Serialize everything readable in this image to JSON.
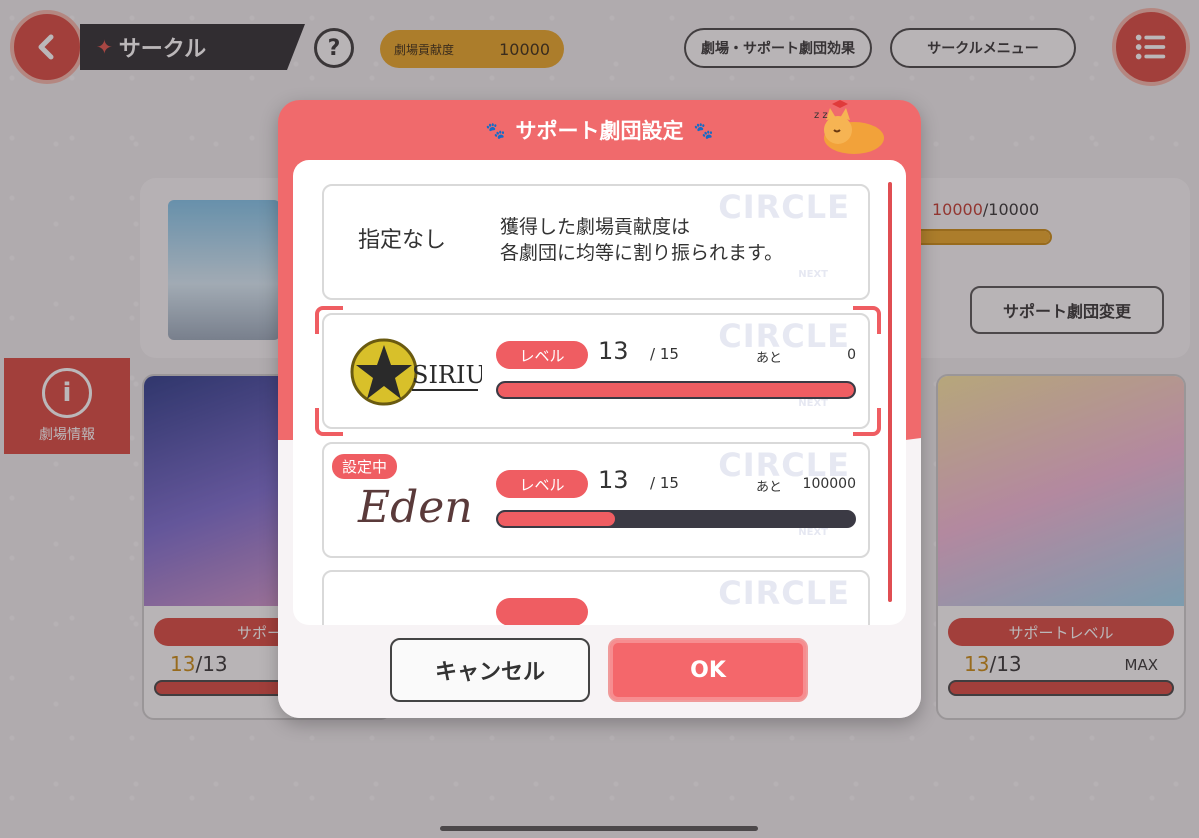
{
  "topbar": {
    "title": "サークル",
    "help_label": "?",
    "contribution_label": "劇場貢献度",
    "contribution_value": "10000",
    "effects_button": "劇場・サポート劇団効果",
    "menu_button": "サークルメニュー"
  },
  "theater": {
    "progress_current": "10000",
    "progress_total": "/10000",
    "progress_fraction": 1.0,
    "change_button": "サポート劇団変更",
    "info_label": "劇場情報"
  },
  "troupe_cards": [
    {
      "pill": "サポート",
      "level_current": "13",
      "level_total": "/13",
      "max": ""
    },
    {
      "pill": "サポートレベル",
      "level_current": "13",
      "level_total": "/13",
      "max": "MAX"
    }
  ],
  "dialog": {
    "title": "サポート劇団設定",
    "watermark": "CIRCLE",
    "next_mark": "NEXT",
    "none_option": {
      "label": "指定なし",
      "desc_line1": "獲得した劇場貢献度は",
      "desc_line2": "各劇団に均等に割り振られます。"
    },
    "rows": [
      {
        "logo_text": "SIRIUS",
        "level_label": "レベル",
        "level": "13",
        "max": "/ 15",
        "remain_label": "あと",
        "remain_value": "0",
        "progress_fraction": 1.0,
        "selected": true,
        "current_badge": ""
      },
      {
        "logo_text": "Eden",
        "level_label": "レベル",
        "level": "13",
        "max": "/ 15",
        "remain_label": "あと",
        "remain_value": "100000",
        "progress_fraction": 0.33,
        "selected": false,
        "current_badge": "設定中"
      }
    ],
    "cancel_button": "キャンセル",
    "ok_button": "OK"
  },
  "colors": {
    "accent_red": "#ef5d62",
    "brand_red": "#d9483e",
    "gold": "#e8a626",
    "dark_bar": "#3b3a44"
  }
}
